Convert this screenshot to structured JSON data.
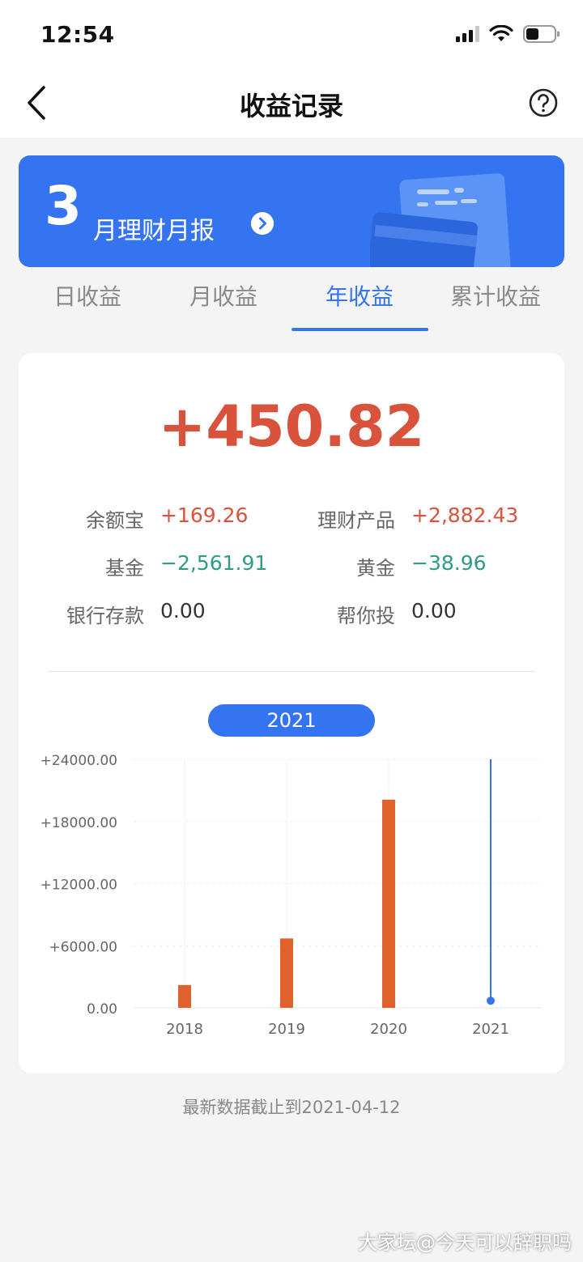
{
  "status": {
    "time": "12:54"
  },
  "header": {
    "title": "收益记录"
  },
  "banner": {
    "month": "3",
    "label": "月理财月报"
  },
  "tabs": [
    {
      "label": "日收益"
    },
    {
      "label": "月收益"
    },
    {
      "label": "年收益"
    },
    {
      "label": "累计收益"
    }
  ],
  "summary": {
    "total": "+450.82",
    "items": [
      {
        "label": "余额宝",
        "value": "+169.26"
      },
      {
        "label": "理财产品",
        "value": "+2,882.43"
      },
      {
        "label": "基金",
        "value": "−2,561.91"
      },
      {
        "label": "黄金",
        "value": "−38.96"
      },
      {
        "label": "银行存款",
        "value": "0.00"
      },
      {
        "label": "帮你投",
        "value": "0.00"
      }
    ]
  },
  "selected_year": "2021",
  "chart_data": {
    "type": "bar",
    "categories": [
      "2018",
      "2019",
      "2020",
      "2021"
    ],
    "values": [
      2200,
      6700,
      20100,
      450.82
    ],
    "ylim": [
      0,
      24000
    ],
    "yticks": [
      "0.00",
      "+6000.00",
      "+12000.00",
      "+18000.00",
      "+24000.00"
    ],
    "bar_color": "#e0612b",
    "highlight_color": "#3574f0",
    "grid": true
  },
  "footnote": "最新数据截止到2021-04-12",
  "watermark": "大家坛@今天可以辞职吗",
  "colors": {
    "accent": "#3574f0",
    "positive": "#d9533c",
    "negative": "#2f9b86"
  }
}
